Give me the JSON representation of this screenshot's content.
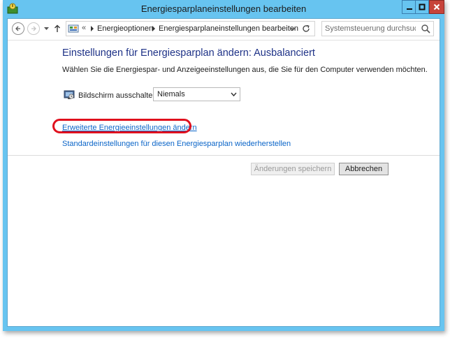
{
  "window": {
    "title": "Energiesparplaneinstellungen bearbeiten"
  },
  "navbar": {
    "breadcrumbs": [
      "Energieoptionen",
      "Energiesparplaneinstellungen bearbeiten"
    ],
    "overflow_chevron": "«",
    "search_placeholder": "Systemsteuerung durchsuchen"
  },
  "main": {
    "heading": "Einstellungen für Energiesparplan ändern: Ausbalanciert",
    "description": "Wählen Sie die Energiespar- und Anzeigeeinstellungen aus, die Sie für den Computer verwenden möchten.",
    "display_off": {
      "label": "Bildschirm ausschalten:",
      "selected": "Niemals"
    },
    "links": {
      "advanced": "Erweiterte Energieeinstellungen ändern",
      "restore": "Standardeinstellungen für diesen Energiesparplan wiederherstellen"
    }
  },
  "buttons": {
    "save": "Änderungen speichern",
    "cancel": "Abbrechen"
  },
  "colors": {
    "title_bar": "#67c4f0",
    "close_button": "#c7433a",
    "heading": "#1e3287",
    "link": "#0b65c8",
    "annotation_ring": "#e0101e"
  },
  "icons": {
    "app": "power-options-icon",
    "back": "arrow-left-icon",
    "forward": "arrow-right-icon",
    "up": "arrow-up-icon",
    "address": "control-panel-icon",
    "refresh": "refresh-icon",
    "search": "search-icon",
    "monitor": "monitor-icon"
  }
}
